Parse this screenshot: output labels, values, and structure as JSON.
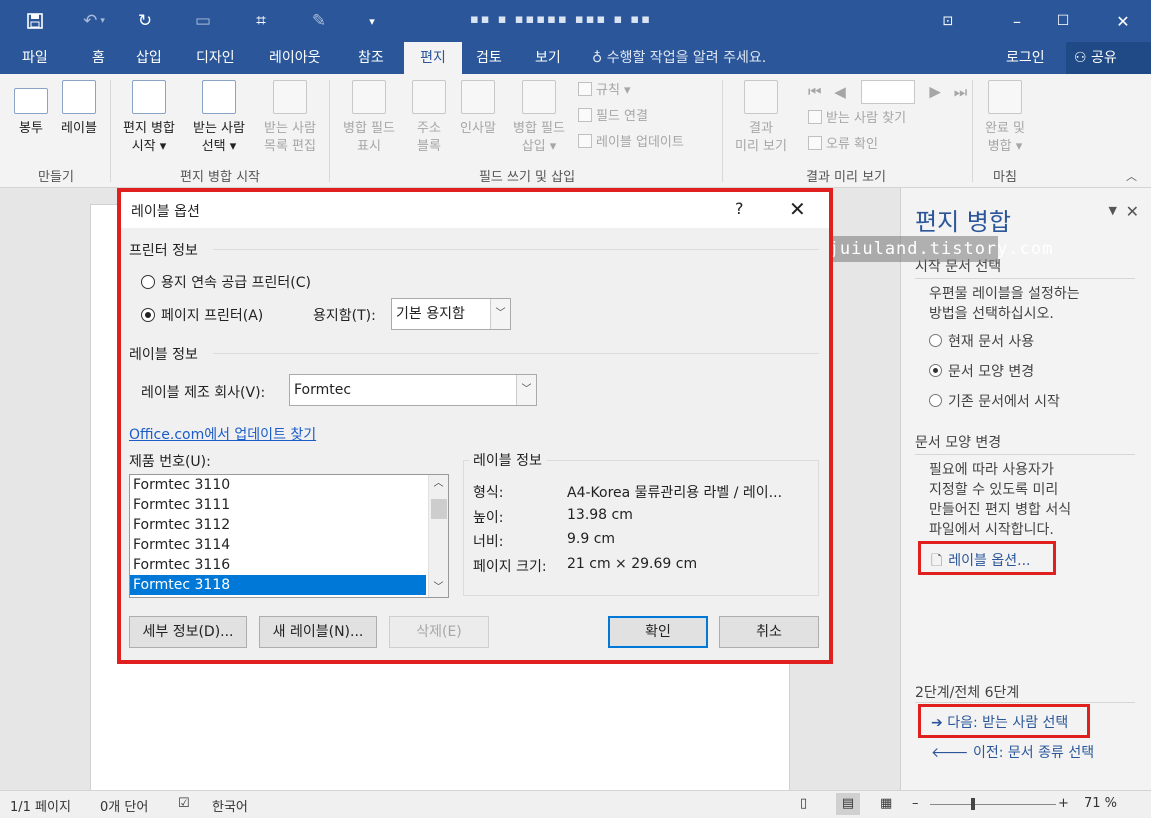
{
  "window": {
    "doc_title": "▪▪ ▪ ▪▪▪▪▪ ▪▪▪ ▪ ▪▪",
    "min": "▭",
    "max": "❐",
    "close": "✕"
  },
  "tabs": [
    "파일",
    "홈",
    "삽입",
    "디자인",
    "레이아웃",
    "참조",
    "편지",
    "검토",
    "보기"
  ],
  "tell_me": "수행할 작업을 알려 주세요.",
  "login": "로그인",
  "share": "공유",
  "ribbon": {
    "envelope": "봉투",
    "labels": "레이블",
    "start_merge_l1": "편지 병합",
    "start_merge_l2": "시작 ▾",
    "select_recip_l1": "받는 사람",
    "select_recip_l2": "선택 ▾",
    "edit_recip_l1": "받는 사람",
    "edit_recip_l2": "목록 편집",
    "highlight_l1": "병합 필드",
    "highlight_l2": "표시",
    "address_l1": "주소",
    "address_l2": "블록",
    "greeting_l1": "인사말",
    "greeting_l2": "",
    "insert_field_l1": "병합 필드",
    "insert_field_l2": "삽입 ▾",
    "rules": "규칙 ▾",
    "match_fields": "필드 연결",
    "update_labels": "레이블 업데이트",
    "preview_l1": "결과",
    "preview_l2": "미리 보기",
    "find_recip": "받는 사람 찾기",
    "check_errors": "오류 확인",
    "finish_l1": "완료 및",
    "finish_l2": "병합 ▾",
    "grp_create": "만들기",
    "grp_start": "편지 병합 시작",
    "grp_write": "필드 쓰기 및 삽입",
    "grp_preview": "결과 미리 보기",
    "grp_finish": "마침"
  },
  "pane": {
    "title": "편지 병합",
    "watermark": "http://juiuland.tistory.com",
    "h1": "시작 문서 선택",
    "desc1_l1": "우편물 레이블을 설정하는",
    "desc1_l2": "방법을 선택하십시오.",
    "opt1": "현재 문서 사용",
    "opt2": "문서 모양 변경",
    "opt3": "기존 문서에서 시작",
    "h2": "문서 모양 변경",
    "desc2_l1": "필요에 따라 사용자가",
    "desc2_l2": "지정할 수 있도록 미리",
    "desc2_l3": "만들어진 편지 병합 서식",
    "desc2_l4": "파일에서 시작합니다.",
    "label_options_link": "레이블 옵션...",
    "step": "2단계/전체 6단계",
    "next": "다음: 받는 사람 선택",
    "prev": "이전: 문서 종류 선택"
  },
  "status": {
    "page": "1/1 페이지",
    "words": "0개 단어",
    "lang": "한국어",
    "zoom": "71 %",
    "zoom_value": 0.71
  },
  "dialog": {
    "title": "레이블 옵션",
    "help": "?",
    "close": "✕",
    "printer_info": "프린터 정보",
    "continuous": "용지 연속 공급 프린터(C)",
    "page_printers": "페이지 프린터(A)",
    "tray_label": "용지함(T):",
    "tray_value": "기본 용지함",
    "label_info": "레이블 정보",
    "vendor_label": "레이블 제조 회사(V):",
    "vendor_value": "Formtec",
    "update_link": "Office.com에서 업데이트 찾기",
    "product_label": "제품 번호(U):",
    "products": [
      "Formtec 3110",
      "Formtec 3111",
      "Formtec 3112",
      "Formtec 3114",
      "Formtec 3116",
      "Formtec 3118"
    ],
    "selected_product": "Formtec 3118",
    "info_title": "레이블 정보",
    "type_k": "형식:",
    "type_v": "A4-Korea 물류관리용 라벨 / 레이...",
    "height_k": "높이:",
    "height_v": "13.98 cm",
    "width_k": "너비:",
    "width_v": "9.9 cm",
    "pagesize_k": "페이지 크기:",
    "pagesize_v": "21 cm × 29.69 cm",
    "details_btn": "세부 정보(D)...",
    "new_label_btn": "새 레이블(N)...",
    "delete_btn": "삭제(E)",
    "ok_btn": "확인",
    "cancel_btn": "취소"
  },
  "colors": {
    "accent": "#2b579a",
    "highlight_box": "#e0201e",
    "selection": "#0078d7"
  }
}
